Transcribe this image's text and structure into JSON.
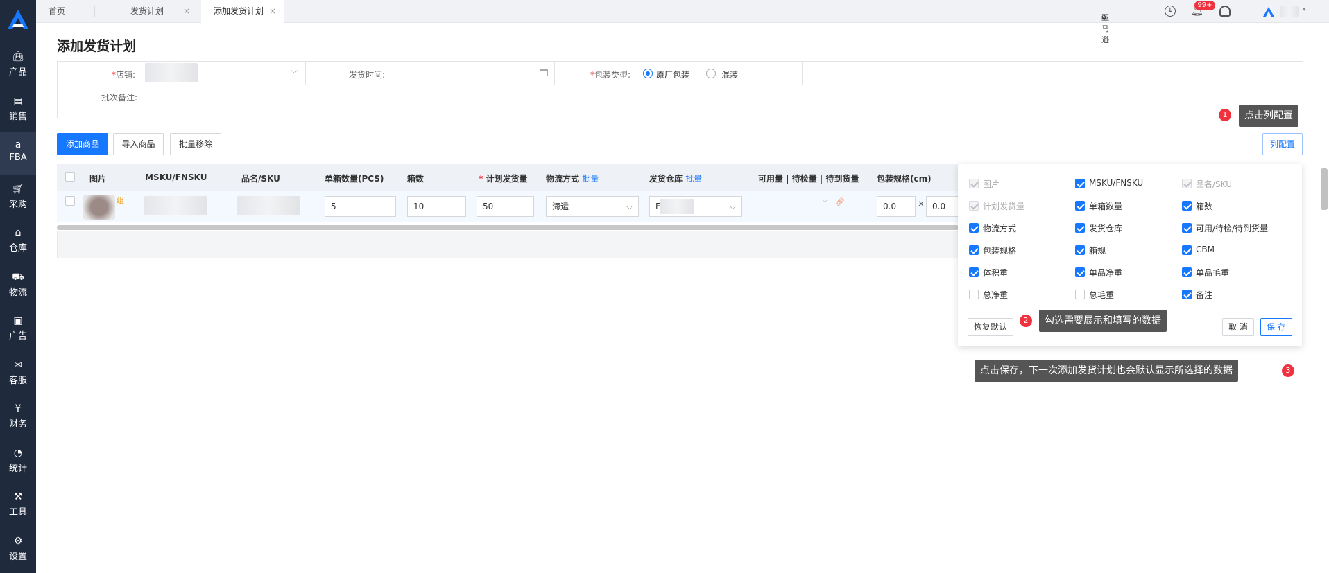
{
  "sidebar": {
    "items": [
      {
        "label": "产品",
        "icon": "bag-icon"
      },
      {
        "label": "销售",
        "icon": "sell-icon"
      },
      {
        "label": "FBA",
        "icon": "amazon-icon"
      },
      {
        "label": "采购",
        "icon": "cart-icon"
      },
      {
        "label": "仓库",
        "icon": "warehouse-icon"
      },
      {
        "label": "物流",
        "icon": "truck-icon"
      },
      {
        "label": "广告",
        "icon": "ad-icon"
      },
      {
        "label": "客服",
        "icon": "mail-icon"
      },
      {
        "label": "财务",
        "icon": "yen-icon"
      },
      {
        "label": "统计",
        "icon": "pie-chart-icon"
      },
      {
        "label": "工具",
        "icon": "wrench-icon"
      },
      {
        "label": "设置",
        "icon": "gear-icon"
      }
    ]
  },
  "tabs": [
    {
      "label": "首页"
    },
    {
      "label": "发货计划",
      "close": "×"
    },
    {
      "label": "添加发货计划",
      "close": "×"
    }
  ],
  "header": {
    "store_label": "亚马逊",
    "notif_badge": "99+"
  },
  "page": {
    "title": "添加发货计划"
  },
  "form": {
    "store_label": "店铺:",
    "ship_time_label": "发货时间:",
    "pack_type_label": "包装类型:",
    "pack_opt1": "原厂包装",
    "pack_opt2": "混装",
    "remark_label": "批次备注:",
    "req": "*"
  },
  "actions": {
    "add": "添加商品",
    "import": "导入商品",
    "remove": "批量移除",
    "column_config": "列配置"
  },
  "table": {
    "headers": {
      "image": "图片",
      "msku": "MSKU/FNSKU",
      "sku": "品名/SKU",
      "per_box": "单箱数量(PCS)",
      "boxes": "箱数",
      "plan_qty": "计划发货量",
      "shipping": "物流方式",
      "warehouse": "发货仓库",
      "batch": "批量",
      "avail": "可用量 | 待检量 | 待到货量",
      "pack_spec": "包装规格(cm)"
    },
    "row": {
      "image_tag": "组",
      "per_box": "5",
      "boxes": "10",
      "plan_qty": "50",
      "shipping": "海运",
      "warehouse_initial": "E",
      "avail_dash": "-",
      "dim1": "0.0",
      "dim_x": "×",
      "dim2": "0.0"
    }
  },
  "column_config": {
    "options": [
      {
        "label": "图片",
        "state": "disabled"
      },
      {
        "label": "MSKU/FNSKU",
        "state": "on"
      },
      {
        "label": "品名/SKU",
        "state": "disabled"
      },
      {
        "label": "计划发货量",
        "state": "disabled"
      },
      {
        "label": "单箱数量",
        "state": "on"
      },
      {
        "label": "箱数",
        "state": "on"
      },
      {
        "label": "物流方式",
        "state": "on"
      },
      {
        "label": "发货仓库",
        "state": "on"
      },
      {
        "label": "可用/待检/待到货量",
        "state": "on"
      },
      {
        "label": "包装规格",
        "state": "on"
      },
      {
        "label": "箱规",
        "state": "on"
      },
      {
        "label": "CBM",
        "state": "on"
      },
      {
        "label": "体积重",
        "state": "on"
      },
      {
        "label": "单品净重",
        "state": "on"
      },
      {
        "label": "单品毛重",
        "state": "on"
      },
      {
        "label": "总净重",
        "state": "off"
      },
      {
        "label": "总毛重",
        "state": "off"
      },
      {
        "label": "备注",
        "state": "on"
      }
    ],
    "reset": "恢复默认",
    "cancel": "取 消",
    "save": "保 存"
  },
  "callouts": [
    {
      "num": "1",
      "text": "点击列配置"
    },
    {
      "num": "2",
      "text": "勾选需要展示和填写的数据"
    },
    {
      "num": "3",
      "text": "点击保存，下一次添加发货计划也会默认显示所选择的数据"
    }
  ],
  "colors": {
    "sidebar": "#1f2a3d",
    "accent": "#1677ff",
    "badge": "#f0313e"
  }
}
